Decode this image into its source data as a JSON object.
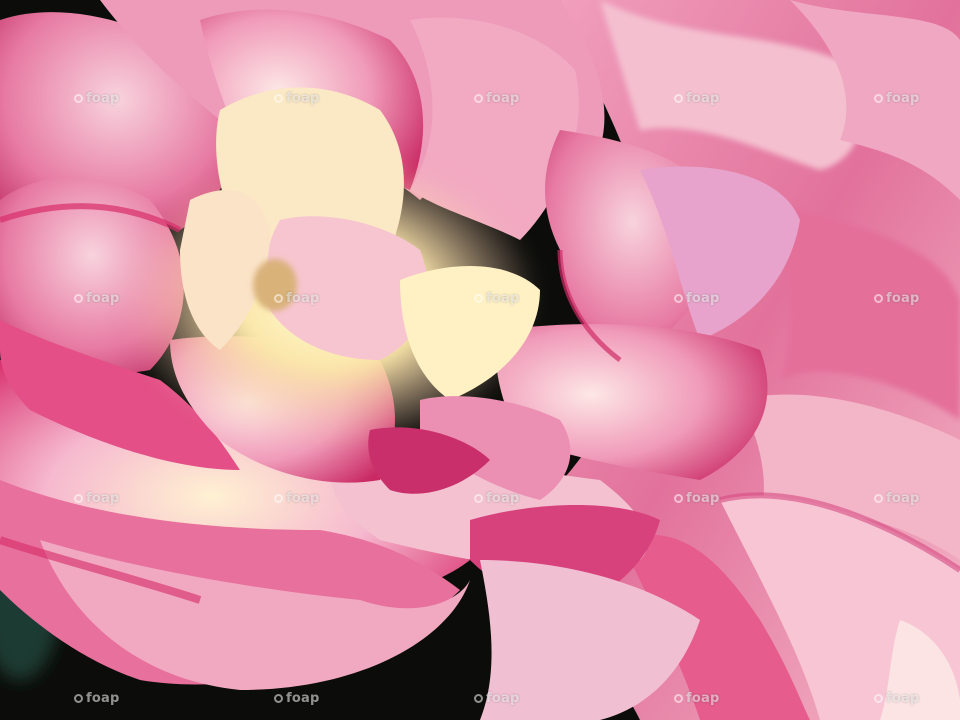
{
  "image": {
    "subject": "pink and cream rose close-up",
    "colors": {
      "background": "#0c0d0a",
      "petal_magenta": "#d8326f",
      "petal_pink": "#ee8fb3",
      "petal_light": "#f7c9d8",
      "center_cream": "#fff3c0",
      "foliage": "#1f3a33"
    }
  },
  "watermark": {
    "text": "foap",
    "rows": 4,
    "cols": 5
  }
}
